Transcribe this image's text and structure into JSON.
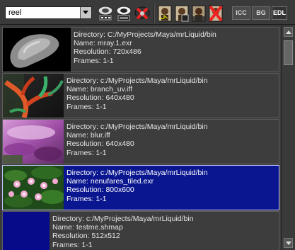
{
  "toolbar": {
    "combo_value": "reel",
    "icc_label": "ICC",
    "bg_label": "BG",
    "edl_label": "EDL"
  },
  "reel": {
    "items": [
      {
        "directory": "Directory: C:/MyProjects/Maya/mrLiquid/bin",
        "name": "Name: mray.1.exr",
        "resolution": "Resolution: 720x486",
        "frames": "Frames: 1-1",
        "thumb_icon": "gray-blob-render"
      },
      {
        "directory": "Directory: c:/MyProjects/Maya/mrLiquid/bin",
        "name": "Name: branch_uv.iff",
        "resolution": "Resolution: 640x480",
        "frames": "Frames: 1-1",
        "thumb_icon": "branch-uv-render"
      },
      {
        "directory": "Directory: c:/MyProjects/Maya/mrLiquid/bin",
        "name": "Name: blur.iff",
        "resolution": "Resolution: 640x480",
        "frames": "Frames: 1-1",
        "thumb_icon": "purple-flower-photo"
      },
      {
        "directory": "Directory: c:/MyProjects/Maya/mrLiquid/bin",
        "name": "Name: nenufares_tiled.exr",
        "resolution": "Resolution: 800x600",
        "frames": "Frames: 1-1",
        "thumb_icon": "water-lilies-photo",
        "selected": true
      },
      {
        "directory": "Directory: c:/MyProjects/Maya/mrLiquid/bin",
        "name": "Name: testme.shmap",
        "resolution": "Resolution: 512x512",
        "frames": "Frames: 1-1",
        "thumb_icon": "blue-shadow-map"
      }
    ]
  },
  "colors": {
    "selection": "#0a168f",
    "background": "#3b3b3b"
  }
}
